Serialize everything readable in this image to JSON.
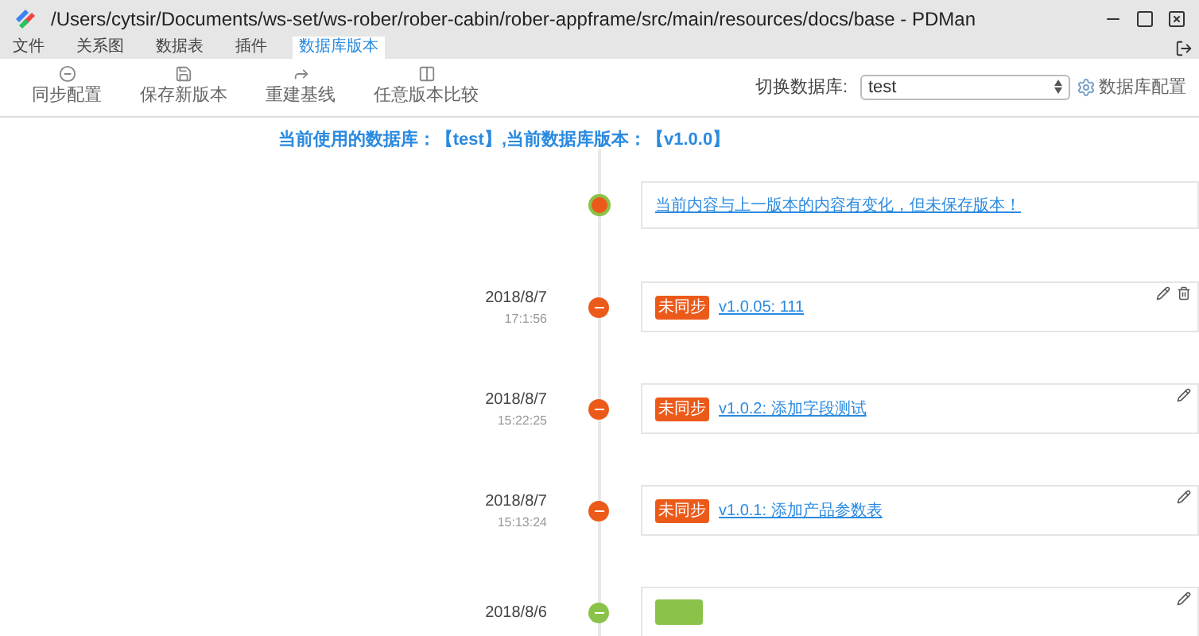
{
  "window": {
    "title": "/Users/cytsir/Documents/ws-set/ws-rober/rober-cabin/rober-appframe/src/main/resources/docs/base - PDMan"
  },
  "menu": [
    {
      "label": "文件",
      "selected": false
    },
    {
      "label": "关系图",
      "selected": false
    },
    {
      "label": "数据表",
      "selected": false
    },
    {
      "label": "插件",
      "selected": false
    },
    {
      "label": "数据库版本",
      "selected": true
    }
  ],
  "toolbar": [
    {
      "label": "同步配置",
      "kind": "sync"
    },
    {
      "label": "保存新版本",
      "kind": "save"
    },
    {
      "label": "重建基线",
      "kind": "rebuild"
    },
    {
      "label": "任意版本比较",
      "kind": "compare"
    }
  ],
  "db_switch": {
    "label": "切换数据库:",
    "value": "test",
    "config": "数据库配置"
  },
  "info": "当前使用的数据库：【test】,当前数据库版本：【v1.0.0】",
  "pending": {
    "text": "当前内容与上一版本的内容有变化，但未保存版本！"
  },
  "versions": [
    {
      "date": "2018/8/7",
      "time": "17:1:56",
      "badge": "未同步",
      "synced": false,
      "title": "v1.0.05: 111",
      "deletable": true
    },
    {
      "date": "2018/8/7",
      "time": "15:22:25",
      "badge": "未同步",
      "synced": false,
      "title": "v1.0.2: 添加字段测试",
      "deletable": false
    },
    {
      "date": "2018/8/7",
      "time": "15:13:24",
      "badge": "未同步",
      "synced": false,
      "title": "v1.0.1: 添加产品参数表",
      "deletable": false
    },
    {
      "date": "2018/8/6",
      "synced": true,
      "deletable": false
    }
  ]
}
